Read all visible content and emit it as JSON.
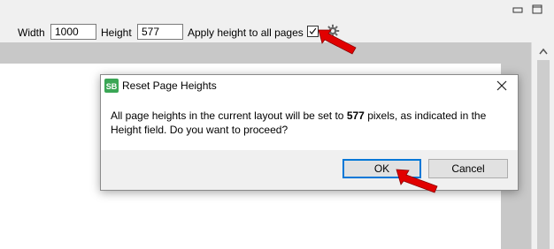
{
  "toolbar": {
    "width_label": "Width",
    "width_value": "1000",
    "height_label": "Height",
    "height_value": "577",
    "apply_label": "Apply height to all pages",
    "apply_checked": true
  },
  "dialog": {
    "title": "Reset Page Heights",
    "message_part1": "All page heights in the current layout will be set to ",
    "message_value": "577",
    "message_part2": " pixels, as indicated in the Height field. Do you want to proceed?",
    "ok_label": "OK",
    "cancel_label": "Cancel",
    "app_icon_text": "SB"
  },
  "colors": {
    "accent": "#0078d7",
    "arrow": "#e10000",
    "app_icon": "#3aa655"
  },
  "icons": [
    "minimize-icon",
    "maximize-icon",
    "checkbox-icon",
    "gear-icon",
    "app-icon",
    "close-icon",
    "red-arrow-icon",
    "scroll-up-icon"
  ]
}
